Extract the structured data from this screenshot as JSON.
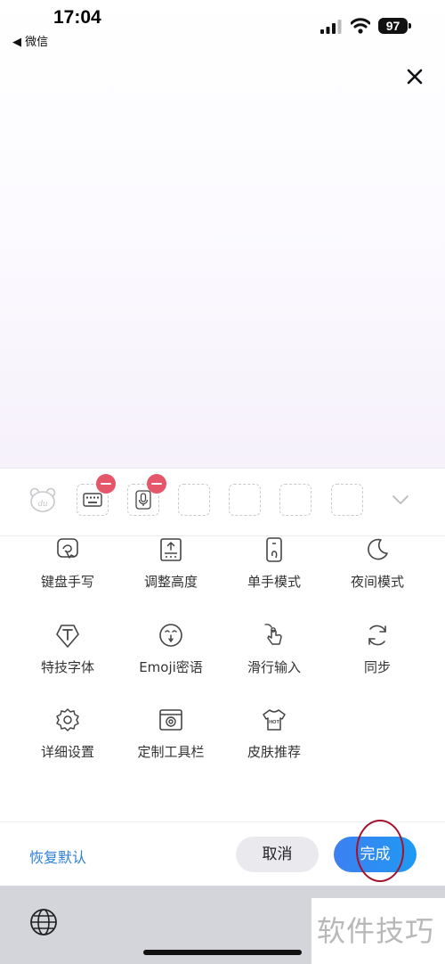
{
  "status_bar": {
    "time": "17:04",
    "back_app": "◀ 微信",
    "battery": "97"
  },
  "top_area": {
    "close_icon": "close-icon"
  },
  "toolbar_slots": {
    "logo_text": "du",
    "slots": [
      {
        "icon": "keyboard-icon",
        "removable": true
      },
      {
        "icon": "microphone-icon",
        "removable": true
      },
      {
        "icon": "empty"
      },
      {
        "icon": "empty"
      },
      {
        "icon": "empty"
      },
      {
        "icon": "empty"
      }
    ],
    "expand_icon": "chevron-down-icon"
  },
  "grid": {
    "items": [
      {
        "label": "键盘手写",
        "icon": "handwriting-icon"
      },
      {
        "label": "调整高度",
        "icon": "adjust-height-icon"
      },
      {
        "label": "单手模式",
        "icon": "one-hand-icon"
      },
      {
        "label": "夜间模式",
        "icon": "moon-icon"
      },
      {
        "label": "特技字体",
        "icon": "font-icon"
      },
      {
        "label": "Emoji密语",
        "icon": "emoji-icon"
      },
      {
        "label": "滑行输入",
        "icon": "swipe-icon"
      },
      {
        "label": "同步",
        "icon": "sync-icon"
      },
      {
        "label": "详细设置",
        "icon": "gear-icon"
      },
      {
        "label": "定制工具栏",
        "icon": "toolbar-icon"
      },
      {
        "label": "皮肤推荐",
        "icon": "skin-icon"
      }
    ]
  },
  "actions": {
    "restore_default": "恢复默认",
    "cancel": "取消",
    "done": "完成"
  },
  "keyboard_bar": {
    "globe_icon": "globe-icon"
  },
  "watermark": "软件技巧",
  "colors": {
    "accent": "#2f7fd6",
    "done_button": "#3d7ff2",
    "remove_badge": "#e5566b",
    "annotation": "#a3132b"
  }
}
